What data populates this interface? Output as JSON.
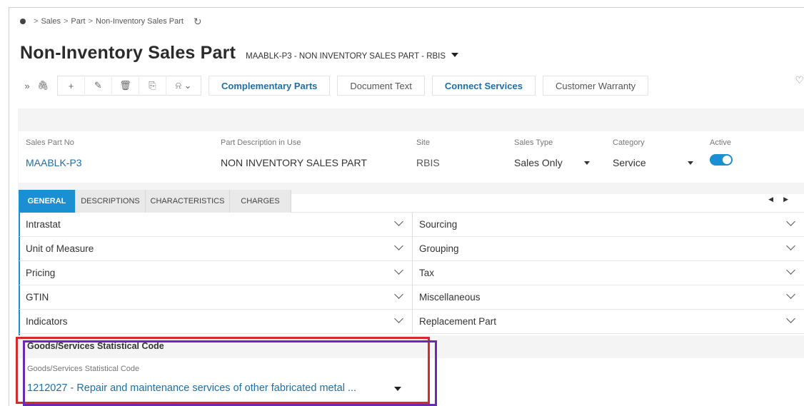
{
  "breadcrumb": {
    "items": [
      "Sales",
      "Part",
      "Non-Inventory Sales Part"
    ],
    "separator": ">"
  },
  "header": {
    "title": "Non-Inventory Sales Part",
    "record": "MAABLK-P3 - NON INVENTORY SALES PART - RBIS"
  },
  "toolbar": {
    "buttons": [
      "Complementary Parts",
      "Document Text",
      "Connect Services",
      "Customer Warranty"
    ]
  },
  "fields": {
    "sales_part_no": {
      "label": "Sales Part No",
      "value": "MAABLK-P3"
    },
    "description": {
      "label": "Part Description in Use",
      "value": "NON INVENTORY SALES PART"
    },
    "site": {
      "label": "Site",
      "value": "RBIS"
    },
    "sales_type": {
      "label": "Sales Type",
      "value": "Sales Only"
    },
    "category": {
      "label": "Category",
      "value": "Service"
    },
    "active": {
      "label": "Active",
      "value": true
    }
  },
  "tabs": [
    "GENERAL",
    "DESCRIPTIONS",
    "CHARACTERISTICS",
    "CHARGES"
  ],
  "active_tab": "GENERAL",
  "groups": {
    "left": [
      "Intrastat",
      "Unit of Measure",
      "Pricing",
      "GTIN",
      "Indicators"
    ],
    "right": [
      "Sourcing",
      "Grouping",
      "Tax",
      "Miscellaneous",
      "Replacement Part"
    ]
  },
  "goods_section": {
    "title": "Goods/Services Statistical Code",
    "field_label": "Goods/Services Statistical Code",
    "value": "1212027 - Repair and maintenance services of other fabricated metal ..."
  },
  "colors": {
    "accent": "#1a8fd1",
    "link": "#1b6fab",
    "highlight_red": "#d62b2b",
    "highlight_purple": "#6a2bb0"
  }
}
